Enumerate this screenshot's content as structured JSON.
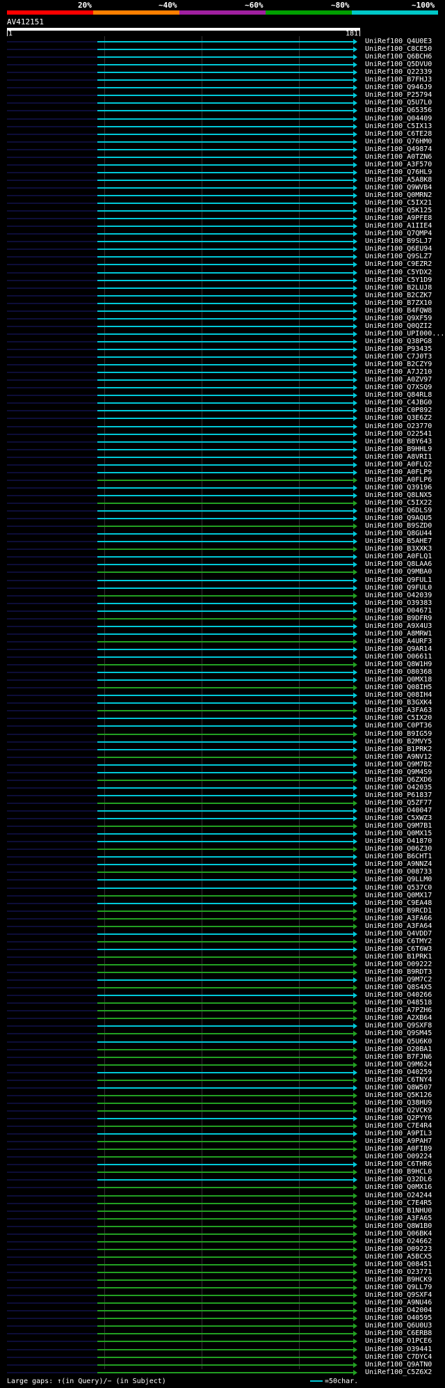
{
  "legend": [
    {
      "label": "20%",
      "color": "#ff0000"
    },
    {
      "label": "~40%",
      "color": "#ff7f00"
    },
    {
      "label": "~60%",
      "color": "#a020a0"
    },
    {
      "label": "~80%",
      "color": "#00a000"
    },
    {
      "label": "~100%",
      "color": "#00c8c8"
    }
  ],
  "query": {
    "name": "AV412151",
    "start": "1",
    "end": "181"
  },
  "colors": {
    "cyan": "#00c8d8",
    "green": "#22a022",
    "navy": "#1a1a70"
  },
  "hits": [
    "UniRef100_Q4U0E3",
    "UniRef100_C8CE50",
    "UniRef100_Q6BCH6",
    "UniRef100_Q5DVU0",
    "UniRef100_Q22339",
    "UniRef100_B7FHJ3",
    "UniRef100_Q946J9",
    "UniRef100_P25794",
    "UniRef100_Q5U7L0",
    "UniRef100_Q65356",
    "UniRef100_Q04409",
    "UniRef100_C5IX13",
    "UniRef100_C6TE28",
    "UniRef100_Q76HM0",
    "UniRef100_Q49874",
    "UniRef100_A0TZN6",
    "UniRef100_A3F570",
    "UniRef100_Q76HL9",
    "UniRef100_A5A8K8",
    "UniRef100_Q9WVB4",
    "UniRef100_Q0MRN2",
    "UniRef100_C5IX21",
    "UniRef100_Q5K125",
    "UniRef100_A9PFE8",
    "UniRef100_A1IIE4",
    "UniRef100_Q7QMP4",
    "UniRef100_B9SLJ7",
    "UniRef100_Q6EU94",
    "UniRef100_Q9SLZ7",
    "UniRef100_C9EZR2",
    "UniRef100_C5YDX2",
    "UniRef100_C5Y1D9",
    "UniRef100_B2LUJ8",
    "UniRef100_B2CZK7",
    "UniRef100_B7ZX10",
    "UniRef100_B4FQW8",
    "UniRef100_Q9XF59",
    "UniRef100_Q0QZI2",
    "UniRef100_UPI000...",
    "UniRef100_Q38PG8",
    "UniRef100_P93435",
    "UniRef100_C7J0T3",
    "UniRef100_B2CZY9",
    "UniRef100_A7J210",
    "UniRef100_A0ZV97",
    "UniRef100_Q7XSQ9",
    "UniRef100_Q84RL8",
    "UniRef100_C4JBG0",
    "UniRef100_C0P892",
    "UniRef100_Q3E6Z2",
    "UniRef100_O23770",
    "UniRef100_O22541",
    "UniRef100_B8Y643",
    "UniRef100_B9HHL9",
    "UniRef100_A8VRI1",
    "UniRef100_A0FLQ2",
    "UniRef100_A0FLP9",
    "UniRef100_A0FLP6",
    "UniRef100_Q39196",
    "UniRef100_Q8LNX5",
    "UniRef100_C5IX22",
    "UniRef100_Q6DLS9",
    "UniRef100_Q9AQU5",
    "UniRef100_B9SZD0",
    "UniRef100_Q8GU44",
    "UniRef100_B5AHE7",
    "UniRef100_B3XXK3",
    "UniRef100_A0FLQ1",
    "UniRef100_Q8LAA6",
    "UniRef100_Q9MBA0",
    "UniRef100_Q9FUL1",
    "UniRef100_Q9FUL0",
    "UniRef100_O42039",
    "UniRef100_O39383",
    "UniRef100_O04671",
    "UniRef100_B9DFR9",
    "UniRef100_A9X4U3",
    "UniRef100_A8MRW1",
    "UniRef100_A4URF3",
    "UniRef100_Q9AR14",
    "UniRef100_O06611",
    "UniRef100_Q8W1H9",
    "UniRef100_O80368",
    "UniRef100_Q0MX18",
    "UniRef100_Q08IH5",
    "UniRef100_Q08IH4",
    "UniRef100_B3GXK4",
    "UniRef100_A3FA63",
    "UniRef100_C5IX20",
    "UniRef100_C0PT36",
    "UniRef100_B9IG59",
    "UniRef100_B2MVY5",
    "UniRef100_B1PRK2",
    "UniRef100_A9NV12",
    "UniRef100_Q9M7B2",
    "UniRef100_Q9M4S9",
    "UniRef100_Q6ZXD6",
    "UniRef100_O42035",
    "UniRef100_P61837",
    "UniRef100_Q5ZF77",
    "UniRef100_O40047",
    "UniRef100_C5XWZ3",
    "UniRef100_Q9M7B1",
    "UniRef100_Q0MX15",
    "UniRef100_O41870",
    "UniRef100_O06Z30",
    "UniRef100_B6CHT1",
    "UniRef100_A9NNZ4",
    "UniRef100_O08733",
    "UniRef100_Q9LLM0",
    "UniRef100_Q537C0",
    "UniRef100_Q0MX17",
    "UniRef100_C9EA48",
    "UniRef100_B9RCD1",
    "UniRef100_A3FA66",
    "UniRef100_A3FA64",
    "UniRef100_Q4VDD7",
    "UniRef100_C6TMY2",
    "UniRef100_C6T6W3",
    "UniRef100_B1PRK1",
    "UniRef100_O09222",
    "UniRef100_B9RDT3",
    "UniRef100_Q9M7C2",
    "UniRef100_Q8S4X5",
    "UniRef100_O40266",
    "UniRef100_O48518",
    "UniRef100_A7PZH6",
    "UniRef100_A2XB64",
    "UniRef100_Q9SXF8",
    "UniRef100_Q9SM45",
    "UniRef100_Q5U6K0",
    "UniRef100_O20BA1",
    "UniRef100_B7FJN6",
    "UniRef100_Q9M624",
    "UniRef100_O40259",
    "UniRef100_C6TNY4",
    "UniRef100_Q8W507",
    "UniRef100_Q5K126",
    "UniRef100_Q38HU9",
    "UniRef100_Q2VCK9",
    "UniRef100_Q2PYY6",
    "UniRef100_C7E4R4",
    "UniRef100_A9PIL3",
    "UniRef100_A9PAH7",
    "UniRef100_A0FIB9",
    "UniRef100_O09224",
    "UniRef100_C6THR6",
    "UniRef100_B9HCL0",
    "UniRef100_Q32DL6",
    "UniRef100_Q0MX16",
    "UniRef100_O24244",
    "UniRef100_C7E4R5",
    "UniRef100_B1NHU0",
    "UniRef100_A3FA65",
    "UniRef100_Q8W1B0",
    "UniRef100_Q06BK4",
    "UniRef100_O24662",
    "UniRef100_O09223",
    "UniRef100_A5BCX5",
    "UniRef100_Q08451",
    "UniRef100_O23771",
    "UniRef100_B9HCK9",
    "UniRef100_Q9LL79",
    "UniRef100_Q9SXF4",
    "UniRef100_A9NU46",
    "UniRef100_O42004",
    "UniRef100_O40595",
    "UniRef100_Q6U0U3",
    "UniRef100_C6ERB8",
    "UniRef100_O1PCE6",
    "UniRef100_O39441",
    "UniRef100_C7DYC4",
    "UniRef100_Q9ATN0",
    "UniRef100_C5Z6X2"
  ],
  "footer": {
    "text": "Large gaps: ↑(in Query)/− (in Subject)",
    "scale": "=50char."
  }
}
